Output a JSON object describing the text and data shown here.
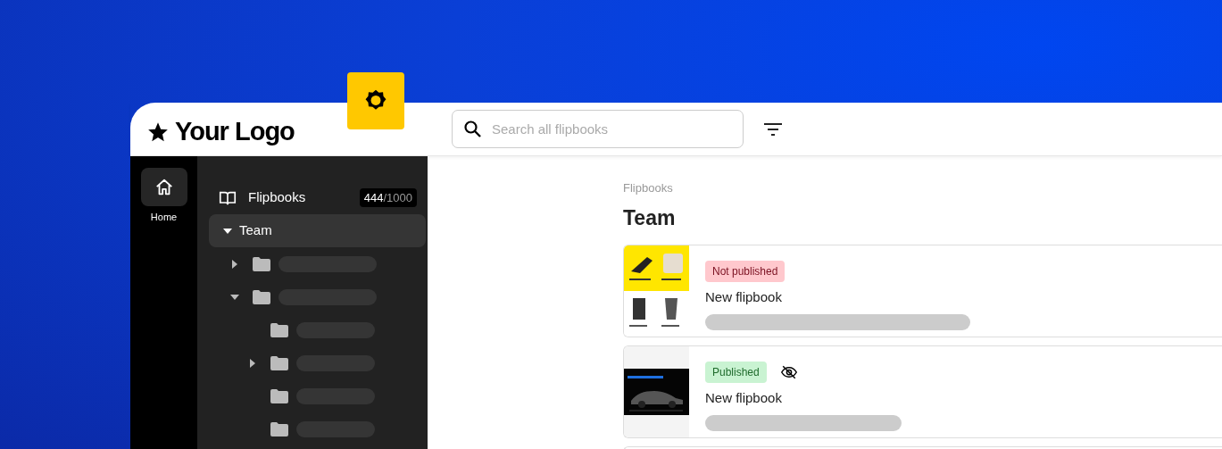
{
  "logo": {
    "text": "Your Logo"
  },
  "search": {
    "placeholder": "Search all flipbooks"
  },
  "rail": [
    {
      "label": "Home",
      "selected": true
    }
  ],
  "sidebar": {
    "title": "Flipbooks",
    "count": "444",
    "limit": "/1000",
    "tree": [
      {
        "label": "Team",
        "selected": true,
        "expandable": true,
        "expanded": true,
        "children": [
          {
            "expandable": true,
            "expanded": false
          },
          {
            "expandable": true,
            "expanded": true,
            "children": [
              {
                "expandable": false
              },
              {
                "expandable": true,
                "expanded": false
              },
              {
                "expandable": false
              },
              {
                "expandable": false
              }
            ]
          }
        ]
      }
    ]
  },
  "breadcrumb": "Flipbooks",
  "heading": "Team",
  "cards": [
    {
      "status": "Not published",
      "kind": "unpublished",
      "hidden": false,
      "title": "New flipbook"
    },
    {
      "status": "Published",
      "kind": "published",
      "hidden": true,
      "title": "New flipbook"
    },
    {
      "kind": "cut"
    }
  ]
}
